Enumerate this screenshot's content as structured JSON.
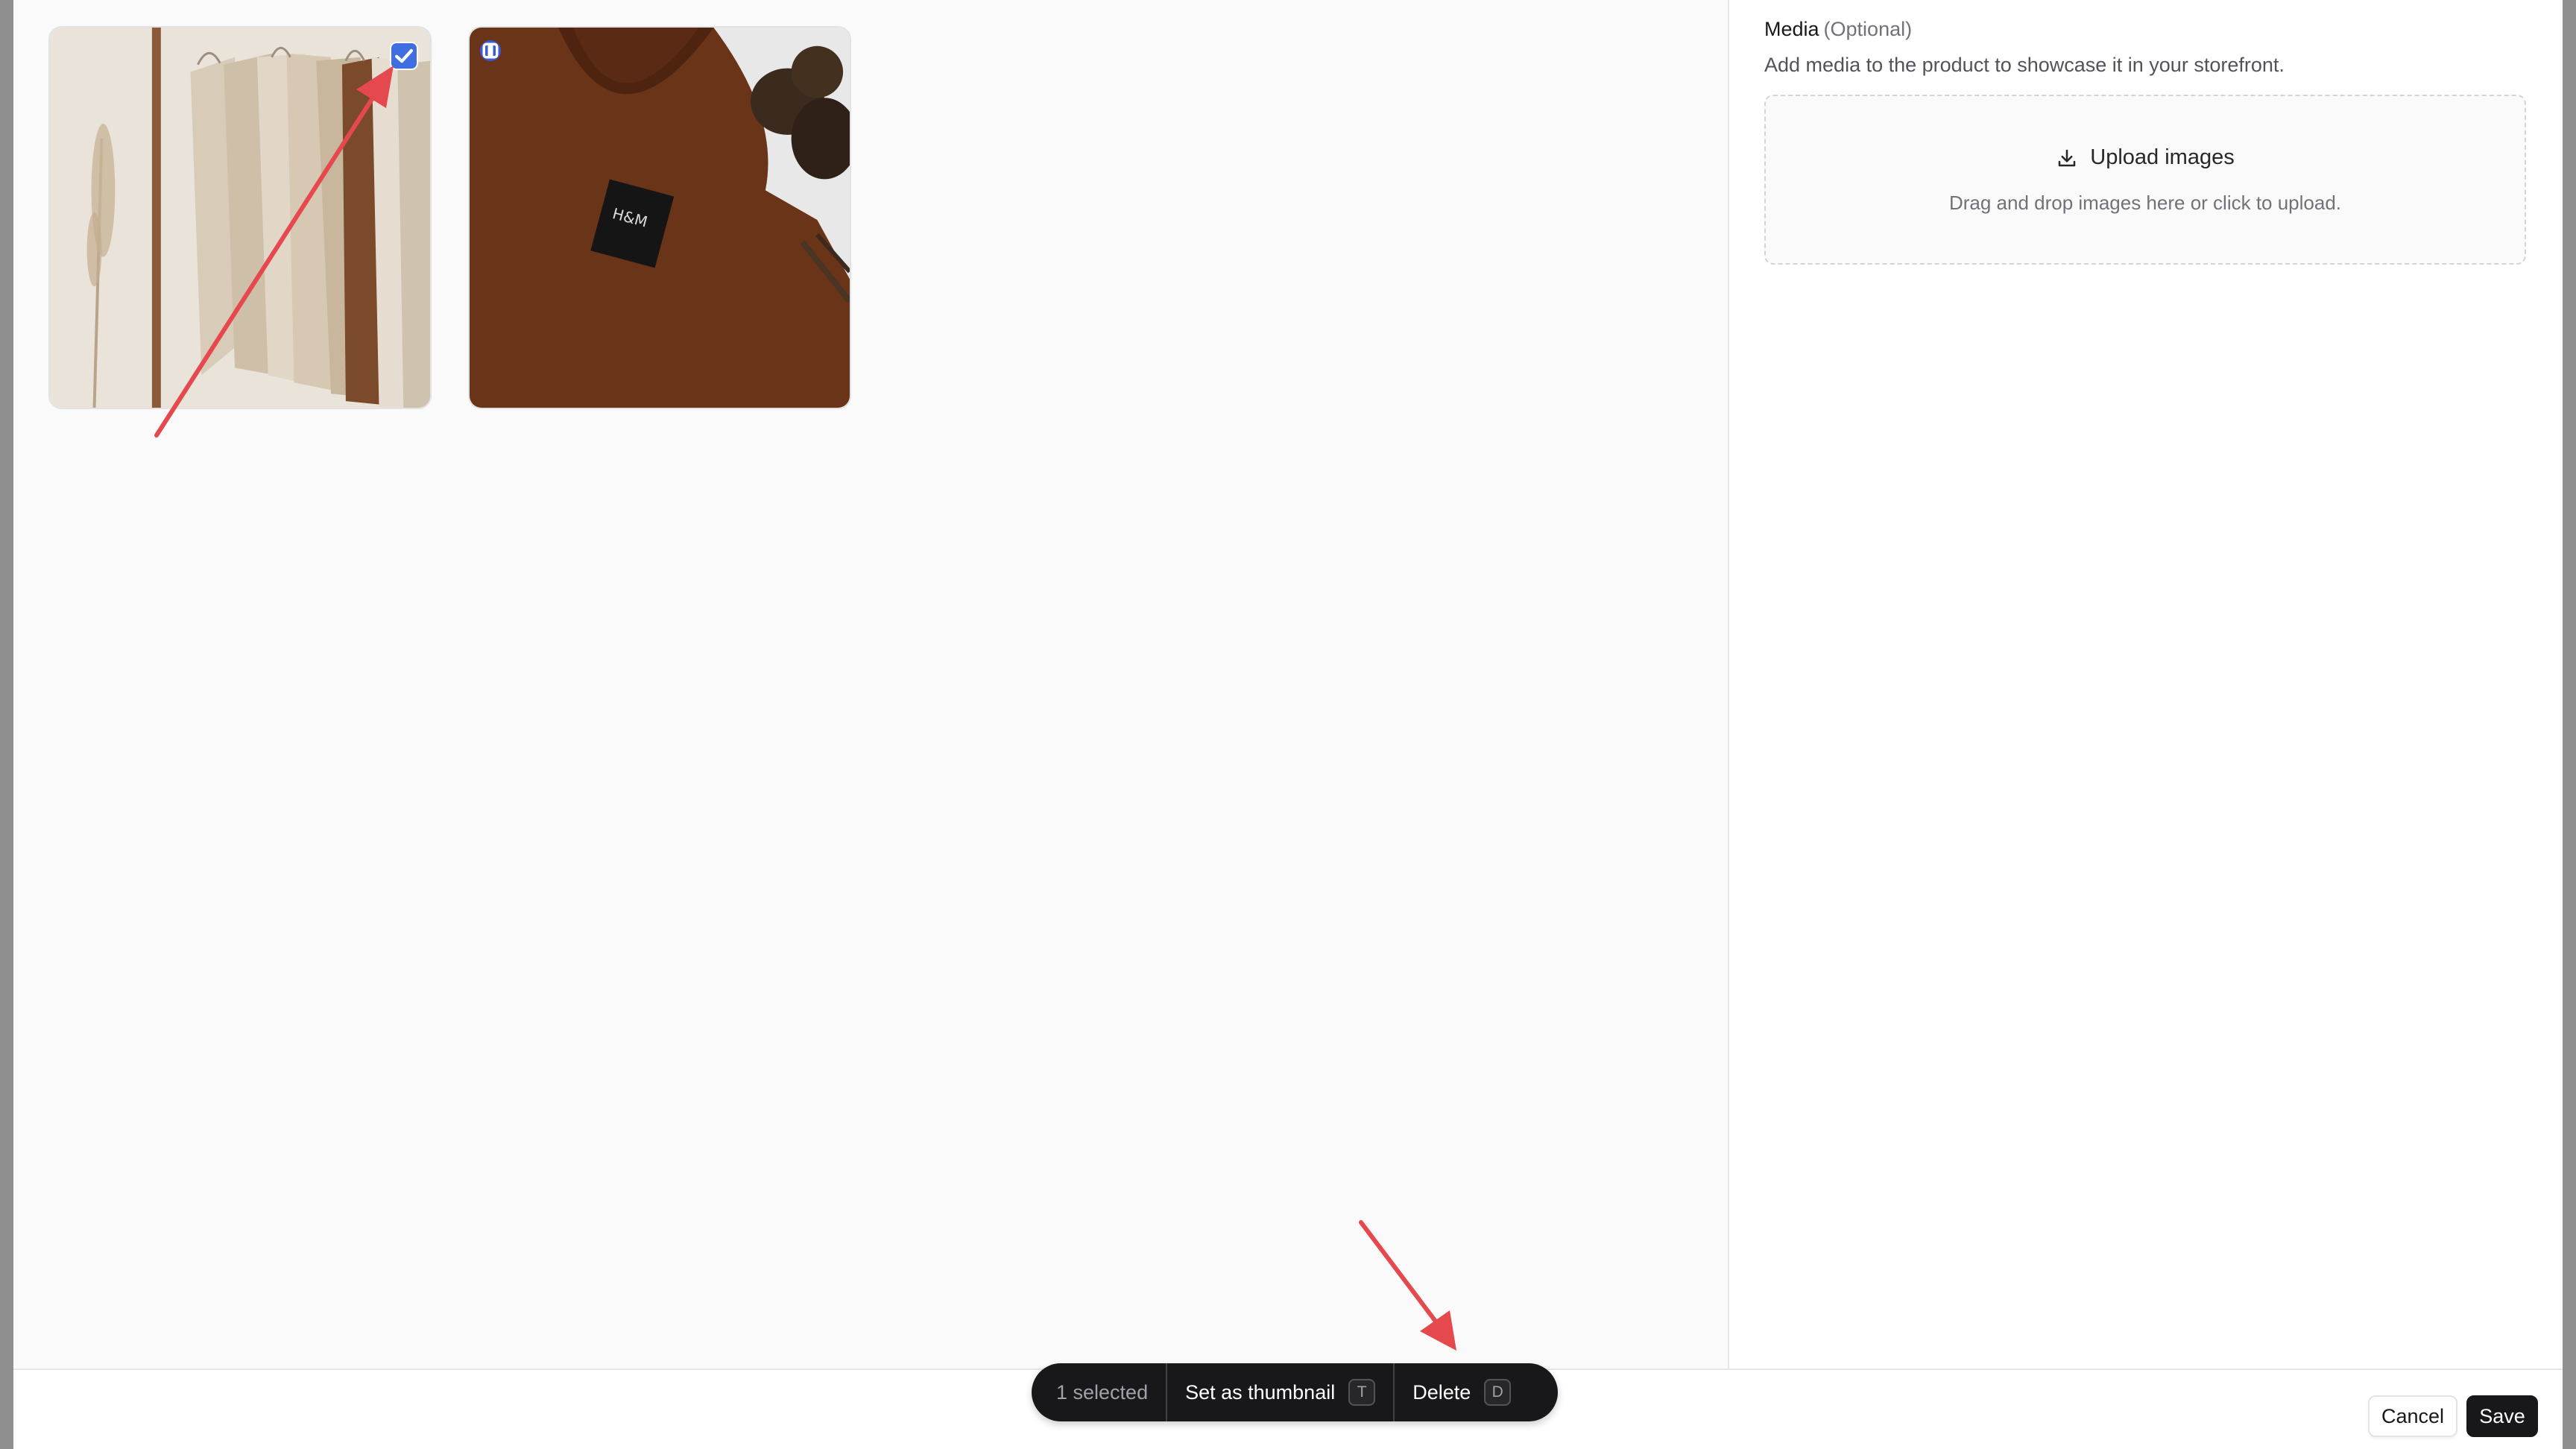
{
  "gallery": {
    "images": [
      {
        "name": "clothes-rack-image",
        "selected": true,
        "is_thumbnail": false
      },
      {
        "name": "brown-sweater-image",
        "selected": false,
        "is_thumbnail": true
      }
    ]
  },
  "media_panel": {
    "label": "Media",
    "optional": "(Optional)",
    "description": "Add media to the product to showcase it in your storefront.",
    "upload_label": "Upload images",
    "upload_hint": "Drag and drop images here or click to upload."
  },
  "command_bar": {
    "selected_count": "1 selected",
    "set_thumbnail_label": "Set as thumbnail",
    "set_thumbnail_key": "T",
    "delete_label": "Delete",
    "delete_key": "D"
  },
  "footer": {
    "cancel_label": "Cancel",
    "save_label": "Save"
  },
  "colors": {
    "accent": "#3f6ee0",
    "annotation_arrow": "#e5484d",
    "dark": "#18181b"
  },
  "icons": [
    "check-icon",
    "thumbnail-badge-icon",
    "upload-icon"
  ]
}
